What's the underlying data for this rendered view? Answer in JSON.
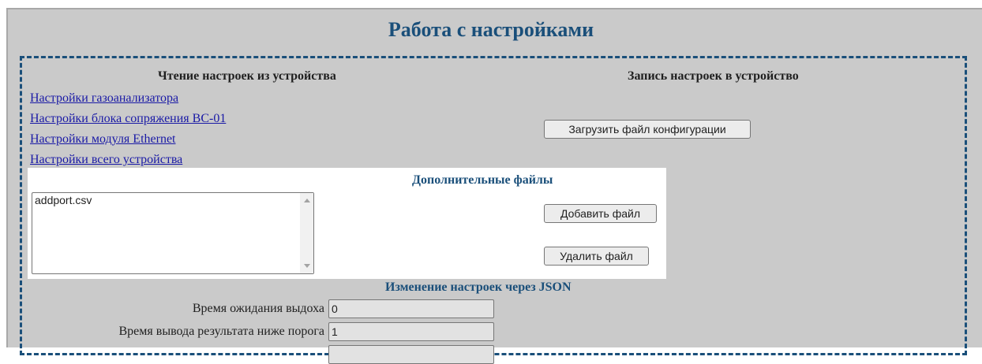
{
  "page": {
    "title": "Работа с настройками"
  },
  "read_section": {
    "heading": "Чтение настроек из устройства",
    "links": [
      "Настройки газоанализатора",
      "Настройки блока сопряжения BC-01",
      "Настройки модуля Ethernet",
      "Настройки всего устройства"
    ]
  },
  "write_section": {
    "heading": "Запись настроек в устройство",
    "upload_button": "Загрузить файл конфигурации"
  },
  "extra_files": {
    "heading": "Дополнительные файлы",
    "files": [
      "addport.csv"
    ],
    "add_button": "Добавить файл",
    "remove_button": "Удалить файл"
  },
  "json_settings": {
    "heading": "Изменение настроек через JSON",
    "fields": [
      {
        "label": "Время ожидания выдоха",
        "value": "0"
      },
      {
        "label": "Время вывода результата ниже порога",
        "value": "1"
      }
    ]
  }
}
